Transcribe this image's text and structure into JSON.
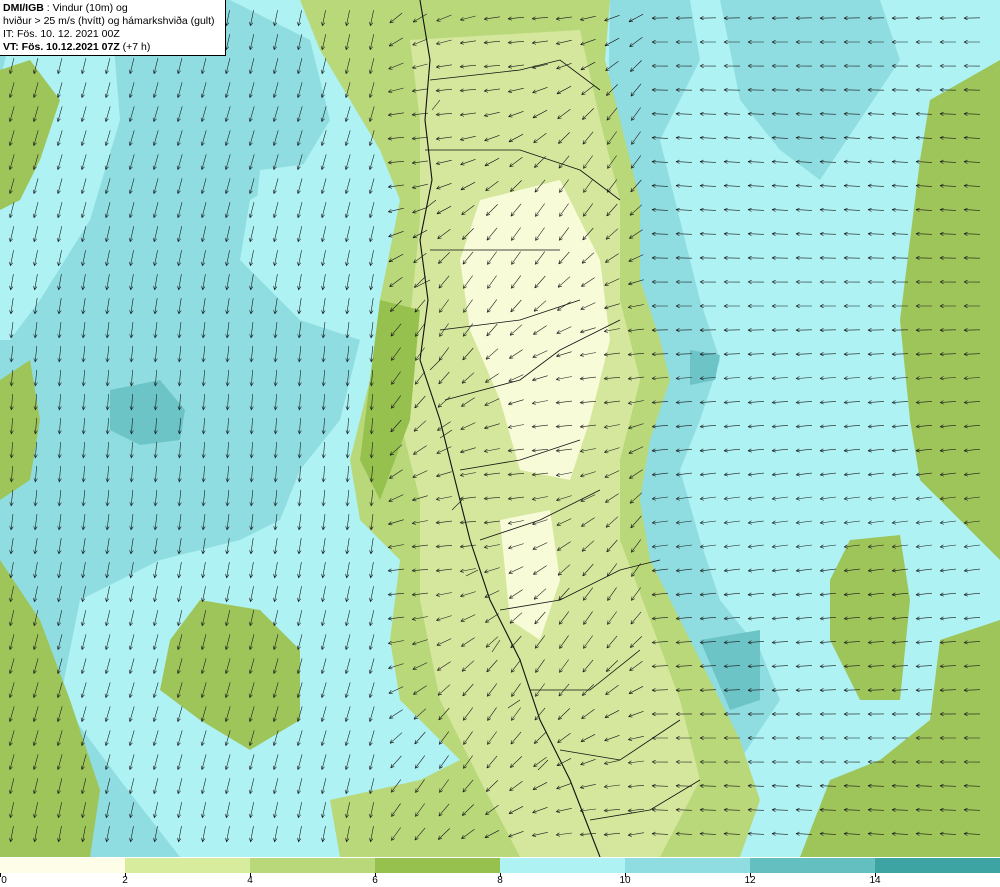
{
  "header": {
    "source": "DMI/IGB",
    "title_rest": " : Vindur (10m) og",
    "line2": "hviður > 25 m/s (hvítt) og hámarkshviða (gult)",
    "issue_time": "IT: Fös. 10. 12. 2021 00Z",
    "valid_label": "VT: Fös. 10.12.2021 07Z",
    "lead_time": " (+7 h)"
  },
  "colors": {
    "land_light": "#f7fbd8",
    "land_mid": "#d4e79c",
    "land_dark": "#bcd97d",
    "land_deep": "#9ec55a",
    "sea_light": "#aef2f4",
    "sea_mid": "#8fdde0",
    "sea_dark": "#6cc4c6",
    "sea_deep": "#3ea3a3",
    "coast": "#111111",
    "arrow": "#1a1a1a"
  },
  "legend": {
    "bins": [
      "#fdfde8",
      "#d8ec9e",
      "#b9d87a",
      "#96c14f",
      "#aef2f4",
      "#8fdde0",
      "#63bfc0",
      "#3ea3a3"
    ],
    "tick_labels": [
      "0",
      "2",
      "4",
      "6",
      "8",
      "10",
      "12",
      "14"
    ]
  }
}
